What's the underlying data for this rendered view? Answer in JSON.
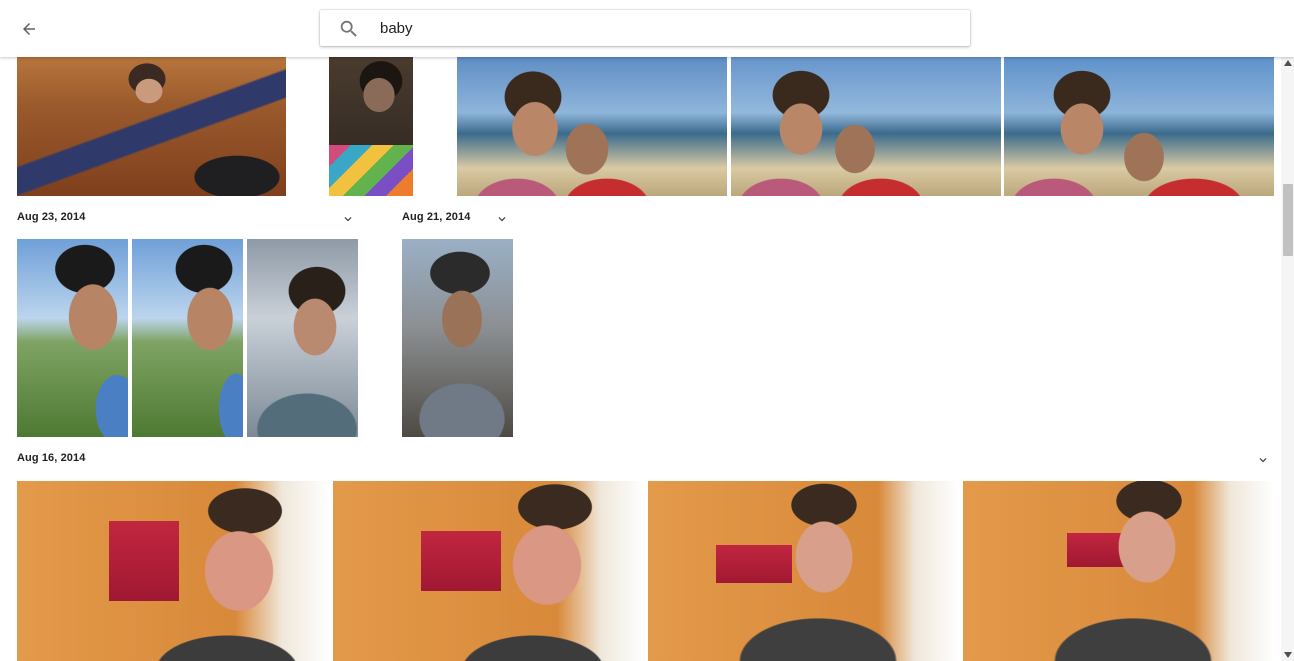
{
  "header": {
    "back_icon": "arrow-back-icon",
    "search_icon": "search-icon",
    "search_value": "baby"
  },
  "groups": [
    {
      "date": "Aug 23, 2014",
      "photos": [
        "Selfie wearing bike helmet outdoors",
        "Selfie with bike helmet, smiling",
        "Selfie with curly hair under cloudy sky"
      ]
    },
    {
      "date": "Aug 21, 2014",
      "photos": [
        "Selfie with bike helmet and hoodie"
      ]
    },
    {
      "date": "Aug 16, 2014",
      "photos": [
        "Mirror selfie with red phone",
        "Mirror selfie with red phone, laughing",
        "Mirror selfie holding red phone",
        "Mirror selfie with red phone, smiling"
      ]
    }
  ],
  "top_row": [
    "Person on couch with laptop",
    "Selfie in patterned sweater",
    "Beach selfie of two people",
    "Beach selfie of two people",
    "Beach selfie of two people"
  ],
  "icons": {
    "group_menu": "chevron-down-icon"
  }
}
